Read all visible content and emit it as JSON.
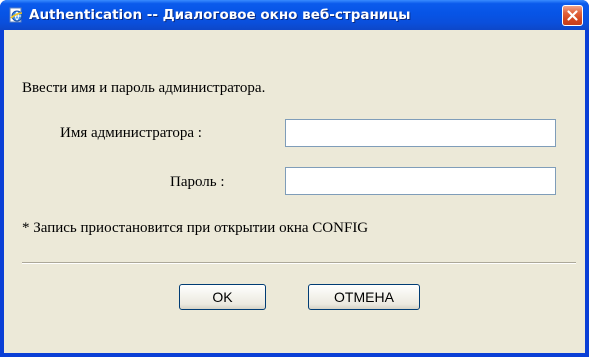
{
  "dialog": {
    "title": "Authentication -- Диалоговое окно веб-страницы",
    "app_icon": "ie-page-icon",
    "close_icon": "close-icon",
    "colors": {
      "titlebar": "#0754e6",
      "close_button": "#d3471f",
      "client_background": "#ece9d8",
      "field_border": "#7f9db9"
    }
  },
  "form": {
    "instruction": "Ввести имя и пароль администратора.",
    "admin_name_label": "Имя администратора :",
    "admin_name_value": "",
    "password_label": "Пароль :",
    "password_value": "",
    "note": "* Запись приостановится при открытии окна CONFIG"
  },
  "buttons": {
    "ok_label": "OK",
    "cancel_label": "ОТМЕНА"
  }
}
